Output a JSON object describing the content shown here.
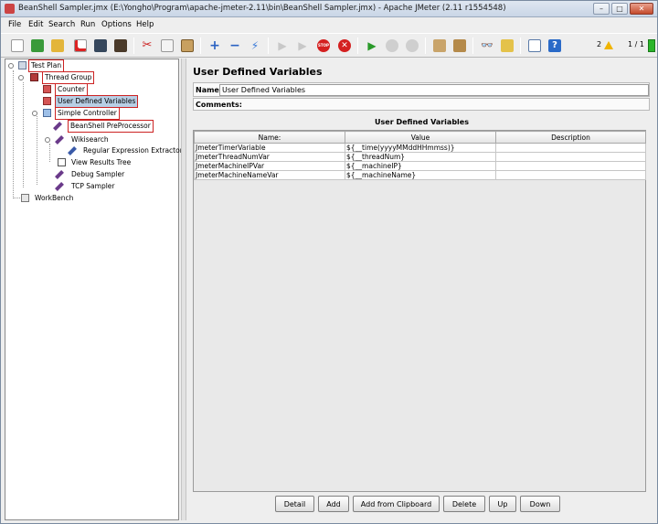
{
  "window": {
    "title": "BeanShell Sampler.jmx (E:\\Yongho\\Program\\apache-jmeter-2.11\\bin\\BeanShell Sampler.jmx) - Apache JMeter (2.11 r1554548)"
  },
  "menu": [
    "File",
    "Edit",
    "Search",
    "Run",
    "Options",
    "Help"
  ],
  "toolbar": {
    "icons": [
      "new-icon",
      "templates-icon",
      "open-icon",
      "close-file-icon",
      "save-icon",
      "save-as-icon",
      "cut-icon",
      "copy-icon",
      "paste-icon",
      "expand-icon",
      "collapse-icon",
      "toggle-icon",
      "start-icon",
      "start-no-pause-icon",
      "stop-icon",
      "shutdown-icon",
      "remote-start-icon",
      "remote-stop-icon",
      "remote-shutdown-icon",
      "clear-icon",
      "clear-all-icon",
      "search-icon",
      "reset-search-icon",
      "function-helper-icon",
      "help-icon"
    ],
    "error_count": "2",
    "threads": "1 / 1"
  },
  "tree": {
    "test_plan": "Test Plan",
    "thread_group": "Thread Group",
    "counter": "Counter",
    "udv": "User Defined Variables",
    "simple_controller": "Simple Controller",
    "beanshell_pre": "BeanShell PreProcessor",
    "wikisearch": "Wikisearch",
    "regex": "Regular Expression Extractor",
    "results_tree": "View Results Tree",
    "debug": "Debug Sampler",
    "tcp": "TCP Sampler",
    "workbench": "WorkBench"
  },
  "main": {
    "title": "User Defined Variables",
    "name_label": "Name:",
    "name_value": "User Defined Variables",
    "comments_label": "Comments:",
    "comments_value": "",
    "section_title": "User Defined Variables",
    "columns": [
      "Name:",
      "Value",
      "Description"
    ],
    "rows": [
      [
        "JmeterTimerVariable",
        "${__time(yyyyMMddHHmmss)}",
        ""
      ],
      [
        "JmeterThreadNumVar",
        "${__threadNum}",
        ""
      ],
      [
        "JmeterMachineIPVar",
        "${__machineIP}",
        ""
      ],
      [
        "JmeterMachineNameVar",
        "${__machineName}",
        ""
      ]
    ],
    "buttons": [
      "Detail",
      "Add",
      "Add from Clipboard",
      "Delete",
      "Up",
      "Down"
    ]
  }
}
